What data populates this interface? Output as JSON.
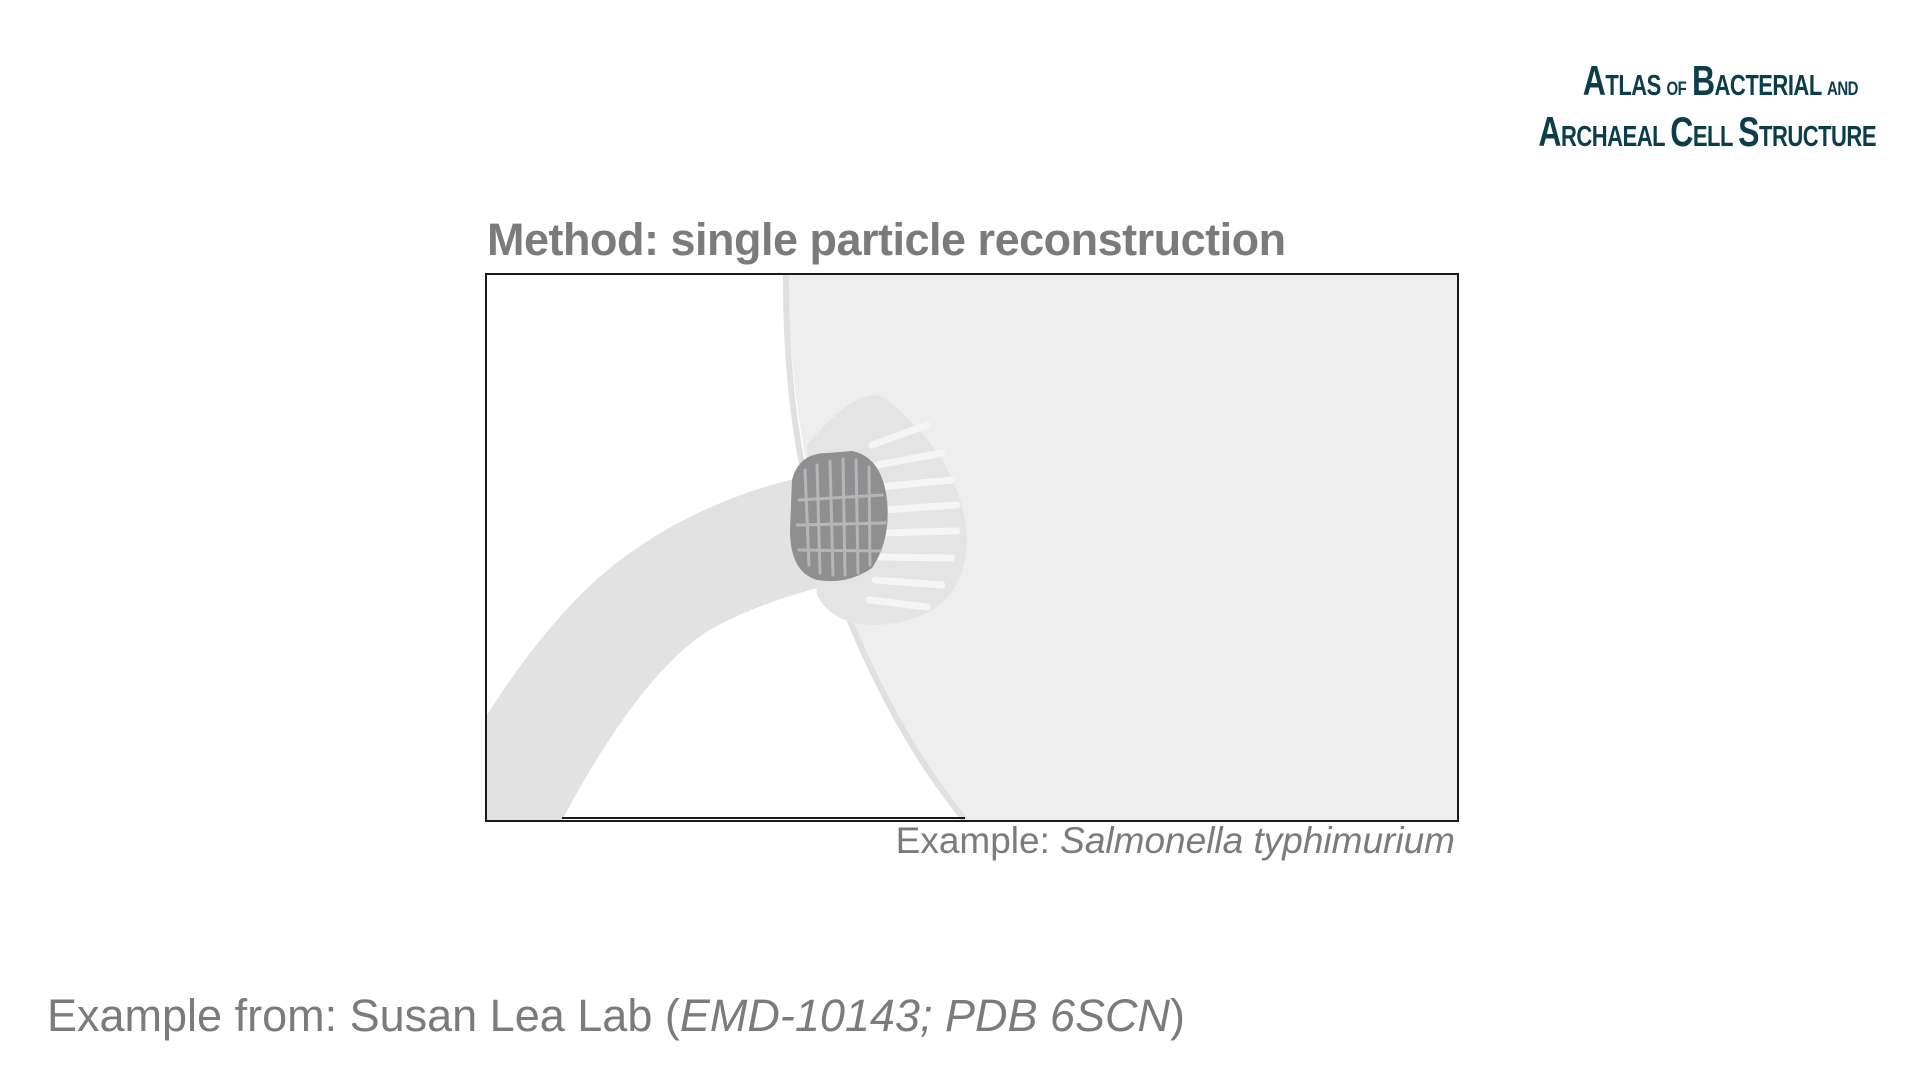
{
  "logo": {
    "line1": {
      "cap": "A",
      "rest": "TLAS",
      "small_of": "OF",
      "cap2": "B",
      "rest2": "ACTERIAL",
      "small_and": "AND"
    },
    "line2": {
      "cap": "A",
      "rest": "RCHAEAL",
      "cap2": "C",
      "rest2": "ELL",
      "cap3": "S",
      "rest3": "TRUCTURE"
    }
  },
  "method_title": "Method: single particle reconstruction",
  "caption": {
    "prefix": "Example:",
    "species": "Salmonella typhimurium"
  },
  "credit": {
    "prefix": "Example from: Susan Lea Lab (",
    "ids": "EMD-10143; PDB 6SCN",
    "suffix": ")"
  },
  "colors": {
    "logo": "#0c3d4a",
    "text_gray": "#7b7b7b",
    "cell_fill": "#eeeeee",
    "flagellum_fill": "#e2e2e2",
    "motor_gray": "#8e8f91"
  }
}
